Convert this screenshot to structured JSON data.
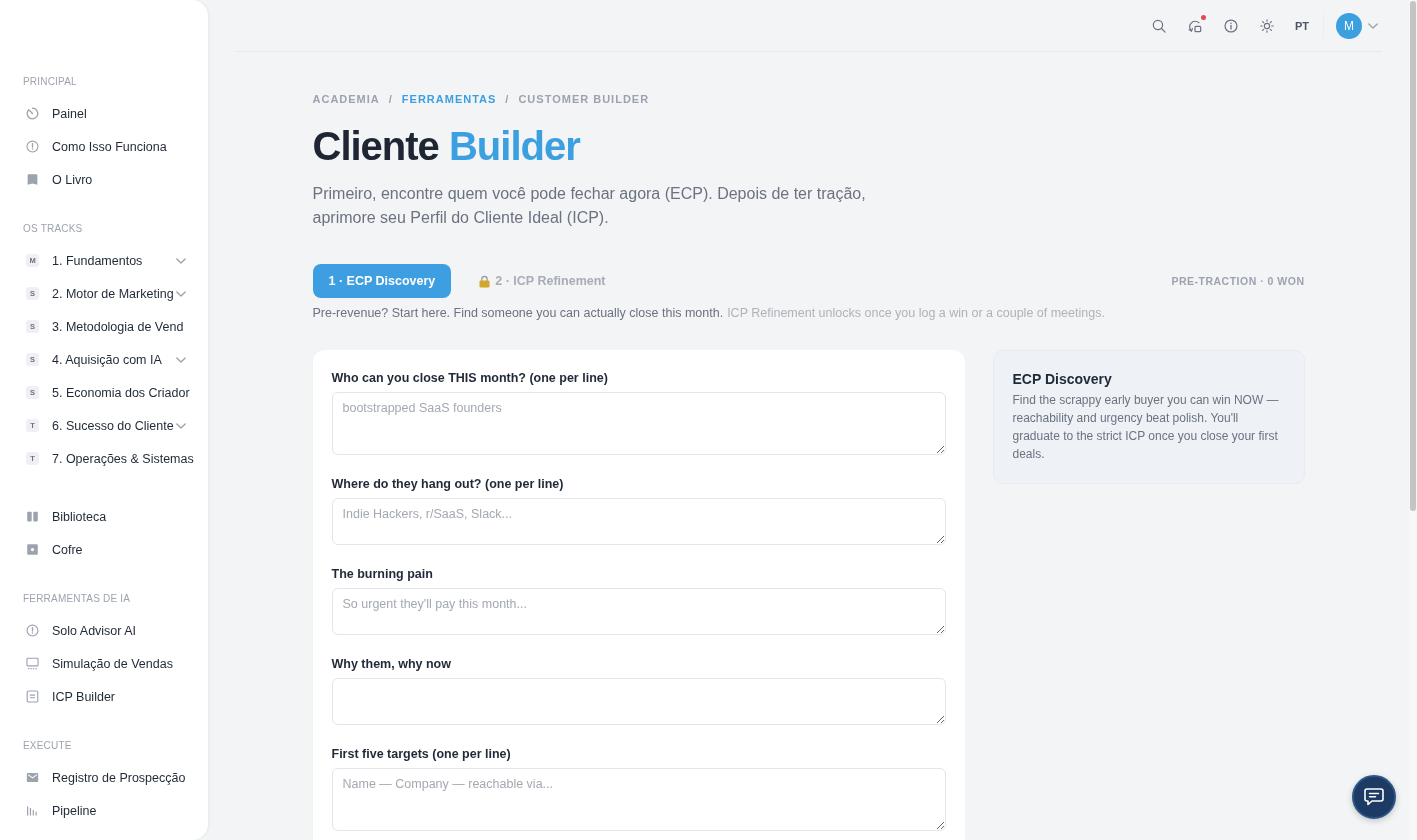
{
  "sidebar": {
    "sections": [
      {
        "title": "PRINCIPAL",
        "items": [
          {
            "kind": "link",
            "label": "Painel",
            "selected": false
          },
          {
            "kind": "link",
            "label": "Como Isso Funciona",
            "selected": false
          },
          {
            "kind": "link",
            "label": "O Livro",
            "selected": false
          }
        ]
      },
      {
        "title": "OS TRACKS",
        "items": [
          {
            "kind": "track",
            "badge": "M",
            "label": "1. Fundamentos",
            "collapsible": true,
            "selected": false
          },
          {
            "kind": "track",
            "badge": "S",
            "label": "2. Motor de Marketing",
            "collapsible": true,
            "selected": false
          },
          {
            "kind": "track",
            "badge": "S",
            "label": "3. Metodologia de Vend",
            "collapsible": false,
            "selected": false
          },
          {
            "kind": "track",
            "badge": "S",
            "label": "4. Aquisição com IA",
            "collapsible": true,
            "selected": false
          },
          {
            "kind": "track",
            "badge": "S",
            "label": "5. Economia dos Criador",
            "collapsible": false,
            "selected": false
          },
          {
            "kind": "track",
            "badge": "T",
            "label": "6. Sucesso do Cliente",
            "collapsible": true,
            "selected": false
          },
          {
            "kind": "track",
            "badge": "T",
            "label": "7. Operações & Sistemas",
            "collapsible": false,
            "selected": false
          }
        ]
      },
      {
        "items": [
          {
            "kind": "link",
            "label": "Biblioteca",
            "selected": false
          },
          {
            "kind": "link",
            "label": "Cofre",
            "selected": false
          }
        ]
      },
      {
        "title": "FERRAMENTAS DE IA",
        "items": [
          {
            "kind": "link",
            "label": "Solo Advisor AI",
            "selected": false
          },
          {
            "kind": "link",
            "label": "Simulação de Vendas",
            "selected": false
          },
          {
            "kind": "link",
            "label": "ICP Builder",
            "selected": false
          }
        ]
      },
      {
        "title": "EXECUTE",
        "items": [
          {
            "kind": "link",
            "label": "Registro de Prospecção",
            "selected": false
          },
          {
            "kind": "link",
            "label": "Pipeline",
            "selected": false
          }
        ]
      }
    ]
  },
  "topbar": {
    "notification": true,
    "language": "PT",
    "avatar": "M"
  },
  "breadcrumb": {
    "items": [
      {
        "label": "ACADEMIA",
        "highlighted": false
      },
      {
        "separator": "/",
        "label": "FERRAMENTAS",
        "highlighted": true
      },
      {
        "separator": "/",
        "label": "CUSTOMER BUILDER",
        "highlighted": false
      }
    ]
  },
  "title": {
    "lead": "Cliente",
    "accent": "Builder"
  },
  "subtitle": "Primeiro, encontre quem você pode fechar agora (ECP). Depois de ter tração, aprimore seu Perfil do Cliente Ideal (ICP).",
  "tabs": [
    {
      "label": "1 · ECP Discovery",
      "selected": true,
      "locked": false
    },
    {
      "label": "2 · ICP Refinement",
      "selected": false,
      "locked": true
    }
  ],
  "stage": "PRE-TRACTION · 0 WON",
  "note": {
    "text": "Pre-revenue? Start here. Find someone you can actually close this month.",
    "hint": "ICP Refinement unlocks once you log a win or a couple of meetings."
  },
  "form": {
    "fields": [
      {
        "kind": "long",
        "label": "Who can you close THIS month? (one per line)",
        "placeholder": "bootstrapped SaaS founders"
      },
      {
        "kind": "short",
        "label": "Where do they hang out? (one per line)",
        "placeholder": "Indie Hackers, r/SaaS, Slack..."
      },
      {
        "kind": "short",
        "label": "The burning pain",
        "placeholder": "So urgent they'll pay this month..."
      },
      {
        "kind": "short",
        "label": "Why them, why now"
      },
      {
        "kind": "long",
        "label": "First five targets (one per line)",
        "placeholder": "Name — Company — reachable via..."
      }
    ]
  },
  "panel": {
    "title": "ECP Discovery",
    "body": "Find the scrappy early buyer you can win NOW — reachability and urgency beat polish. You'll graduate to the strict ICP once you close your first deals."
  }
}
